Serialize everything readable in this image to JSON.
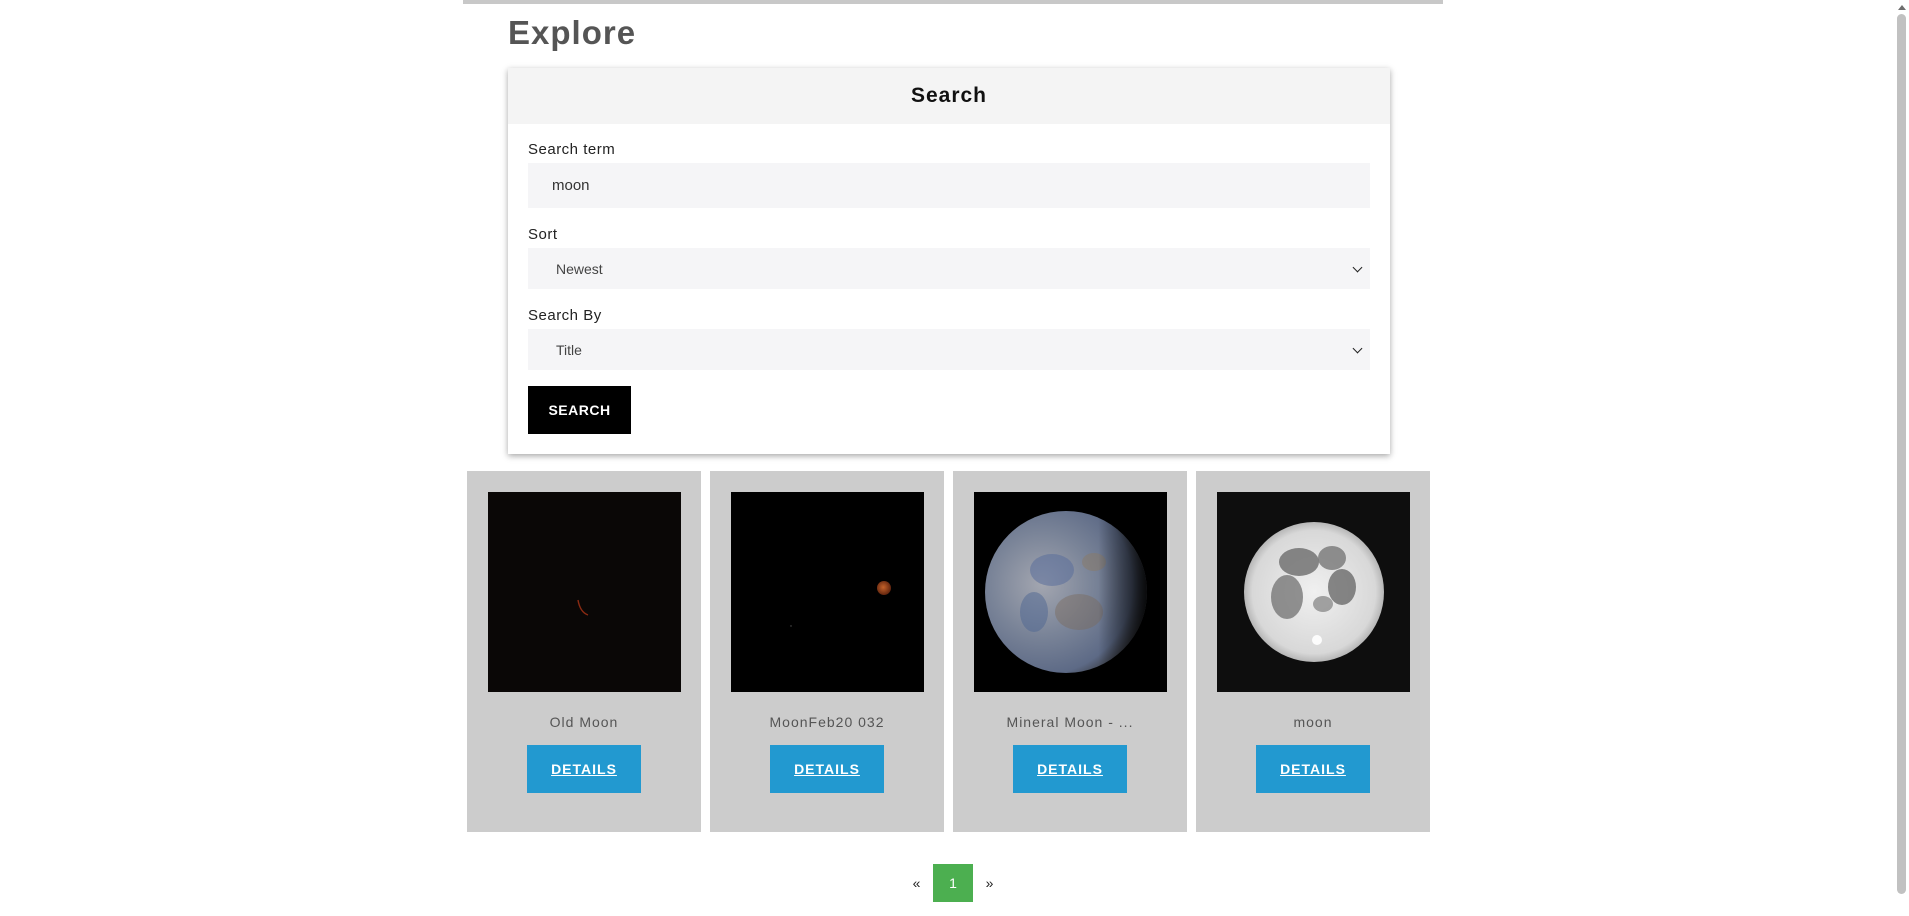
{
  "page": {
    "title": "Explore"
  },
  "search": {
    "header": "Search",
    "term_label": "Search term",
    "term_value": "moon",
    "sort_label": "Sort",
    "sort_selected": "Newest",
    "by_label": "Search By",
    "by_selected": "Title",
    "button_label": "SEARCH"
  },
  "results": [
    {
      "title": "Old Moon",
      "details_label": "DETAILS",
      "image": "old-moon-thumbnail"
    },
    {
      "title": "MoonFeb20 032",
      "details_label": "DETAILS",
      "image": "moonfeb20-thumbnail"
    },
    {
      "title": "Mineral Moon - ...",
      "details_label": "DETAILS",
      "image": "mineral-moon-thumbnail"
    },
    {
      "title": "moon",
      "details_label": "DETAILS",
      "image": "full-moon-thumbnail"
    }
  ],
  "pagination": {
    "prev": "«",
    "current": "1",
    "next": "»"
  },
  "colors": {
    "details_button": "#2299d0",
    "search_button": "#000000",
    "page_current": "#4caf50",
    "card_background": "#cccccc"
  }
}
